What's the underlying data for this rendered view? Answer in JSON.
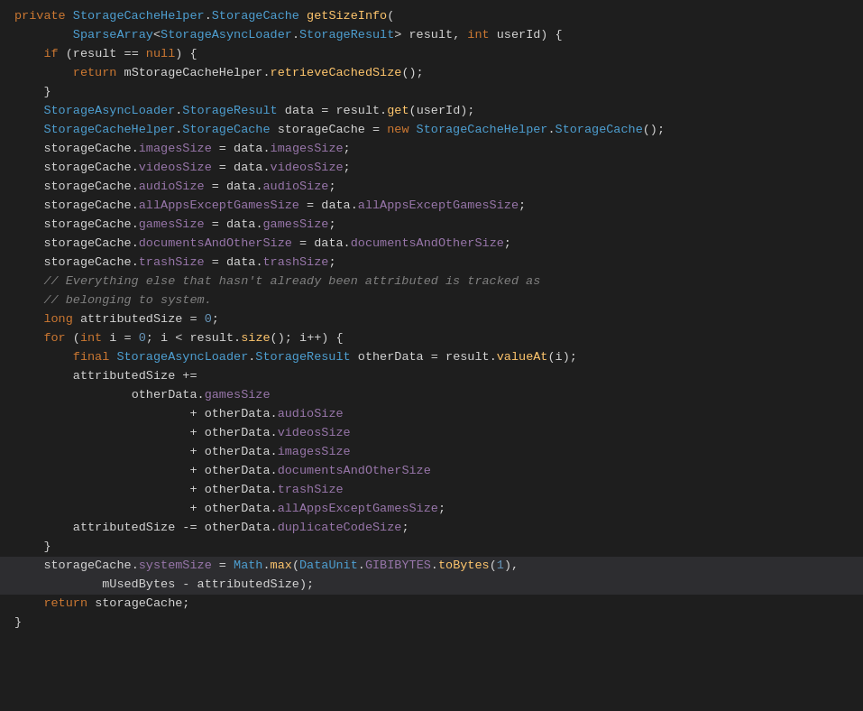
{
  "code": {
    "background": "#1e1e1e",
    "highlight_background": "#2d2d30",
    "lines": [
      {
        "id": 1,
        "highlight": false
      },
      {
        "id": 2,
        "highlight": false
      },
      {
        "id": 3,
        "highlight": false
      },
      {
        "id": 4,
        "highlight": false
      },
      {
        "id": 5,
        "highlight": false
      },
      {
        "id": 6,
        "highlight": false
      },
      {
        "id": 7,
        "highlight": false
      },
      {
        "id": 8,
        "highlight": false
      },
      {
        "id": 9,
        "highlight": false
      },
      {
        "id": 10,
        "highlight": false
      },
      {
        "id": 11,
        "highlight": false
      },
      {
        "id": 12,
        "highlight": false
      },
      {
        "id": 13,
        "highlight": false
      },
      {
        "id": 14,
        "highlight": false
      },
      {
        "id": 15,
        "highlight": false
      },
      {
        "id": 16,
        "highlight": false
      },
      {
        "id": 17,
        "highlight": false
      },
      {
        "id": 18,
        "highlight": false
      },
      {
        "id": 19,
        "highlight": false
      },
      {
        "id": 20,
        "highlight": false
      },
      {
        "id": 21,
        "highlight": false
      },
      {
        "id": 22,
        "highlight": false
      },
      {
        "id": 23,
        "highlight": false
      },
      {
        "id": 24,
        "highlight": false
      },
      {
        "id": 25,
        "highlight": false
      },
      {
        "id": 26,
        "highlight": false
      },
      {
        "id": 27,
        "highlight": false
      },
      {
        "id": 28,
        "highlight": false
      },
      {
        "id": 29,
        "highlight": true
      },
      {
        "id": 30,
        "highlight": true
      },
      {
        "id": 31,
        "highlight": false
      },
      {
        "id": 32,
        "highlight": false
      },
      {
        "id": 33,
        "highlight": false
      }
    ]
  }
}
